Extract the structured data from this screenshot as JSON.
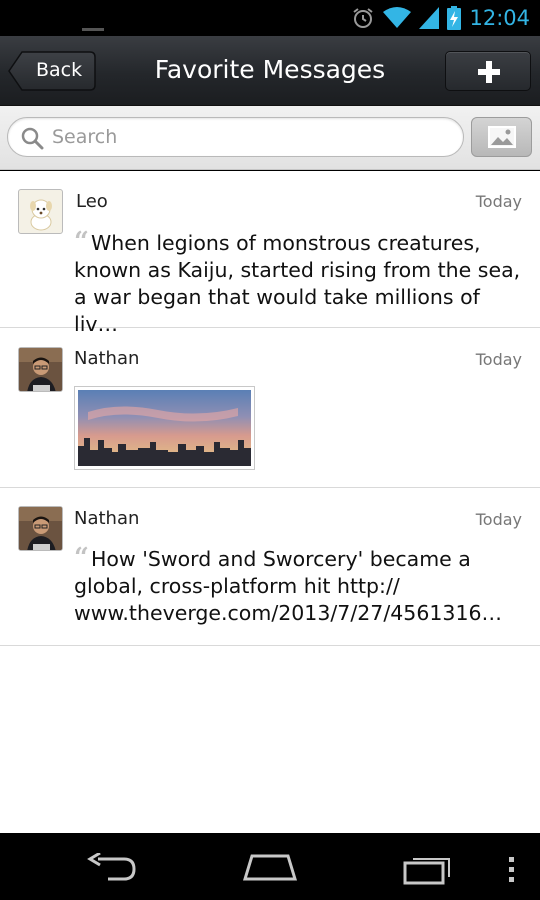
{
  "status_bar": {
    "time": "12:04",
    "icons": [
      "alarm-icon",
      "wifi-icon",
      "signal-icon",
      "battery-charging-icon"
    ]
  },
  "header": {
    "back_label": "Back",
    "title": "Favorite Messages",
    "add_icon": "plus-icon"
  },
  "search": {
    "placeholder": "Search",
    "icon": "search-icon",
    "image_button_icon": "image-icon"
  },
  "messages": [
    {
      "sender": "Leo",
      "date": "Today",
      "text_lines": [
        "When legions of monstrous creatures,",
        "known as Kaiju, started rising from the sea,",
        "a war began that would take millions of liv…"
      ]
    },
    {
      "sender": "Nathan",
      "date": "Today",
      "attachment": "image"
    },
    {
      "sender": "Nathan",
      "date": "Today",
      "text_lines": [
        "How 'Sword and Sworcery' became a",
        "global, cross-platform hit http://",
        "www.theverge.com/2013/7/27/4561316…"
      ]
    }
  ],
  "nav": {
    "icons": [
      "back-nav-icon",
      "home-nav-icon",
      "recent-apps-icon",
      "overflow-menu-icon"
    ]
  },
  "colors": {
    "accent_time": "#33b5e5",
    "quote_mark": "#c3c3c3"
  }
}
